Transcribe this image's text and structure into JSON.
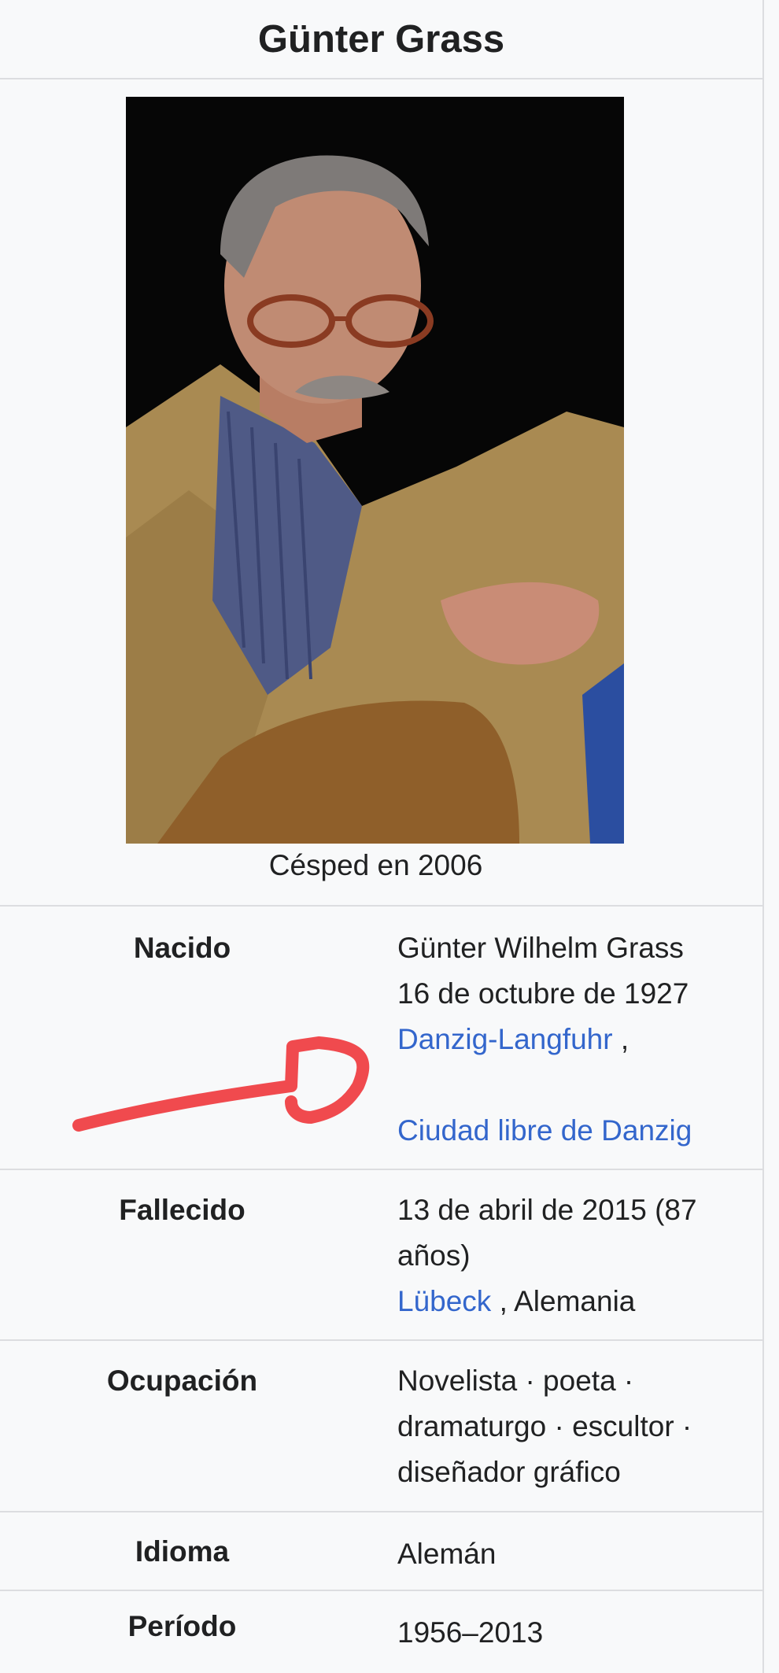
{
  "infobox": {
    "title": "Günter Grass",
    "image_caption": "Césped en 2006",
    "rows": {
      "born": {
        "label": "Nacido",
        "name": "Günter Wilhelm Grass",
        "date": "16 de octubre de 1927",
        "place_link": "Danzig-Langfuhr",
        "place_sep": " ,",
        "city_link": "Ciudad libre de Danzig"
      },
      "died": {
        "label": "Fallecido",
        "date": "13 de abril de 2015 (87 años)",
        "place_link": "Lübeck",
        "place_rest": " , Alemania"
      },
      "occupation": {
        "label": "Ocupación",
        "value": "Novelista · poeta · dramaturgo · escultor · diseñador gráfico"
      },
      "language": {
        "label": "Idioma",
        "value": "Alemán"
      },
      "period": {
        "label": "Período",
        "value": "1956–2013"
      }
    }
  },
  "colors": {
    "link": "#3366cc",
    "annotation": "#f04a4e",
    "background": "#f8f9fa",
    "border": "#dcdde0"
  },
  "icons": {
    "photo": "portrait-photo",
    "annotation": "red-arrow-annotation"
  }
}
